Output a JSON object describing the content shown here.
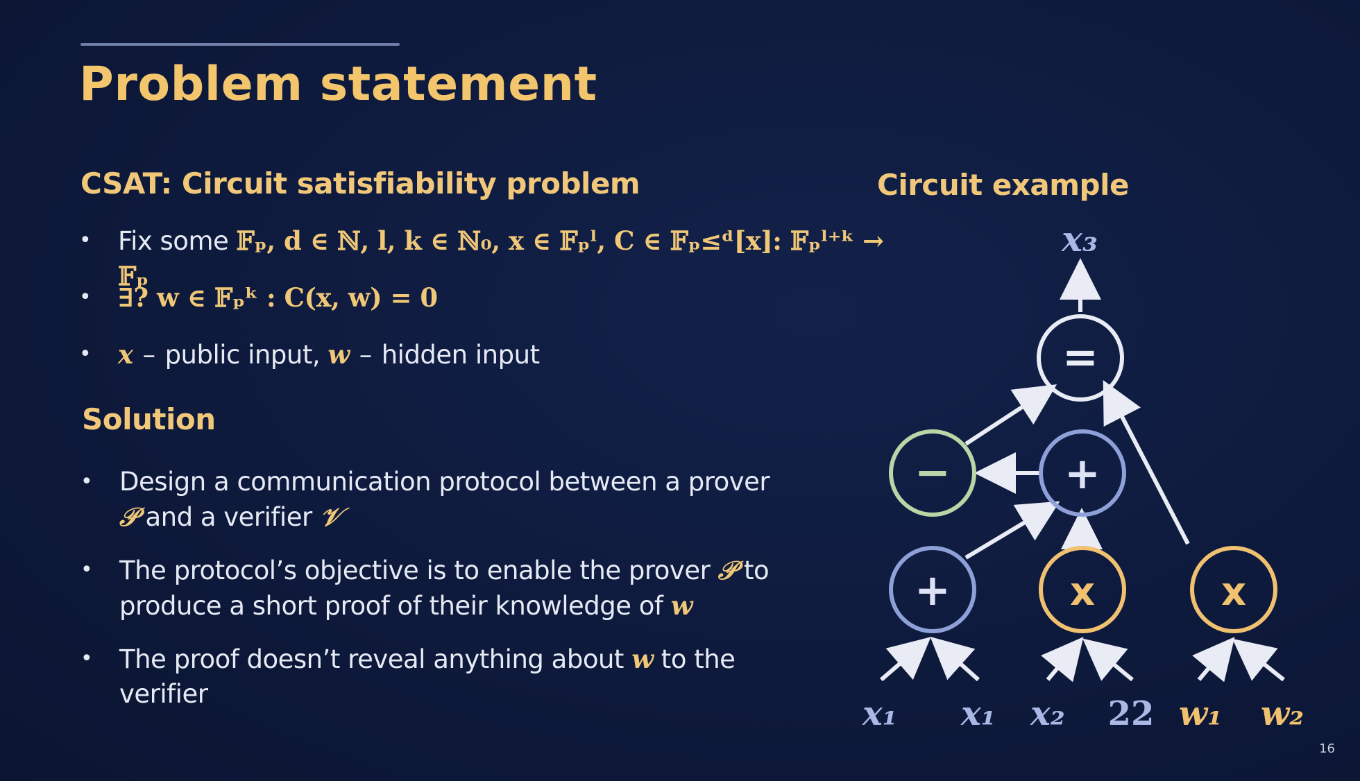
{
  "slide": {
    "title": "Problem statement",
    "page_number": "16"
  },
  "csat": {
    "heading": "CSAT: Circuit satisfiability problem",
    "bullet1": {
      "prefix": "Fix some ",
      "math": "𝔽ₚ, d ∈ ℕ, l, k ∈ ℕ₀, x ∈ 𝔽ₚˡ, C ∈ 𝔽ₚ≤ᵈ[x]: 𝔽ₚˡ⁺ᵏ → 𝔽ₚ"
    },
    "bullet2": {
      "math": "∃? w ∈ 𝔽ₚᵏ : C(x, w) = 0"
    },
    "bullet3": {
      "var_x": "x",
      "text_x": "public input,",
      "var_w": "w",
      "text_w": "hidden input"
    }
  },
  "solution": {
    "heading": "Solution",
    "bullet1": {
      "text_a": "Design a communication protocol between a prover ",
      "prover": "𝒫",
      "text_b": " and a verifier ",
      "verifier": "𝒱"
    },
    "bullet2": {
      "text_a": "The protocol’s objective is to enable the prover ",
      "prover": "𝒫",
      "text_b": " to produce a short proof of their knowledge of ",
      "var_w": "w"
    },
    "bullet3": {
      "text_a": "The proof doesn’t reveal anything about ",
      "var_w": "w",
      "text_b": " to the verifier"
    }
  },
  "circuit": {
    "heading": "Circuit example",
    "output_label": "x₃",
    "nodes": {
      "equals": "=",
      "minus": "−",
      "plus_top": "+",
      "plus_bottom": "+",
      "times_mid": "x",
      "times_right": "x"
    },
    "inputs": [
      "x₁",
      "x₁",
      "x₂",
      "22",
      "w₁",
      "w₂"
    ],
    "colors": {
      "white_node": "#e9ecf5",
      "blue_node": "#8ea0d8",
      "green_node": "#b9d6a6",
      "orange_node": "#f0c170",
      "edge": "#e9ecf5",
      "input_blue": "#aab8e6",
      "input_orange": "#f0c170"
    }
  },
  "theme": {
    "background": "#0f1b3d",
    "title_color": "#f3c56c",
    "text_color": "#e6eaf4"
  }
}
